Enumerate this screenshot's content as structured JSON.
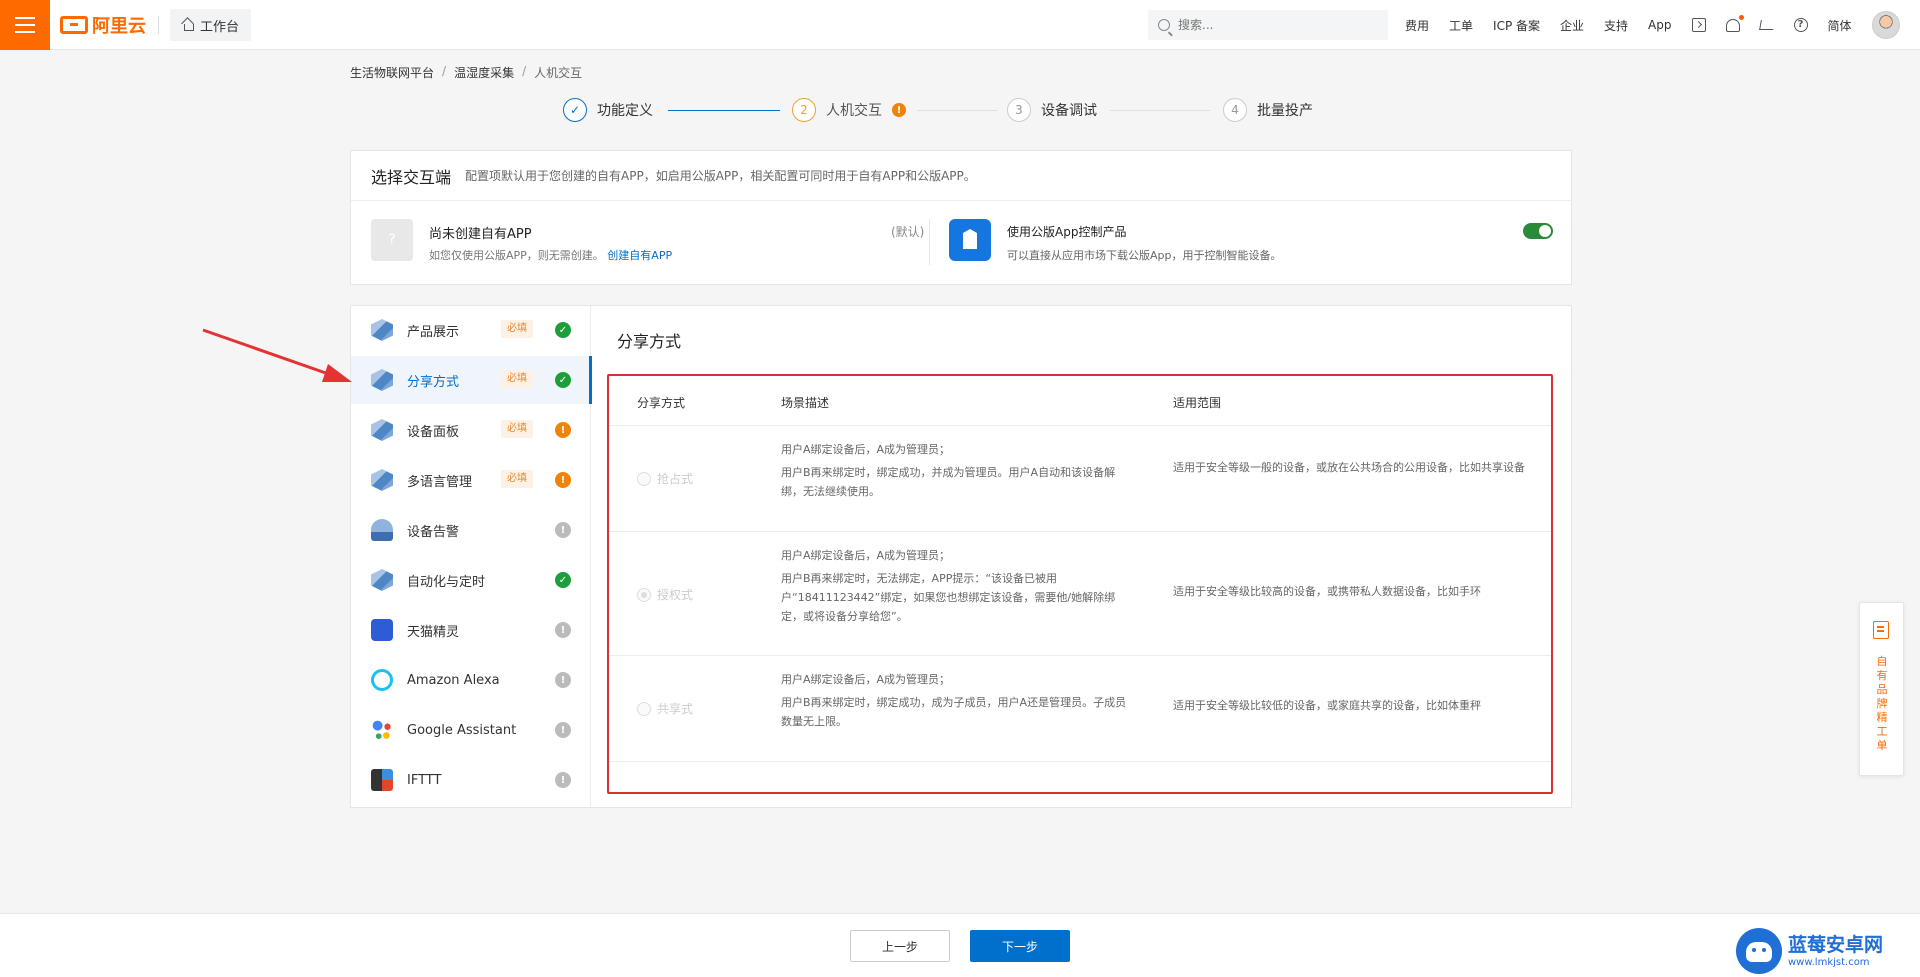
{
  "header": {
    "logo_text": "阿里云",
    "workbench_label": "工作台",
    "search_placeholder": "搜索...",
    "nav": [
      "费用",
      "工单",
      "ICP 备案",
      "企业",
      "支持",
      "App"
    ],
    "lang": "简体",
    "brand_color": "#ff6a00"
  },
  "breadcrumb": [
    "生活物联网平台",
    "温湿度采集",
    "人机交互"
  ],
  "steps": [
    {
      "num": "✓",
      "label": "功能定义",
      "state": "done"
    },
    {
      "num": "2",
      "label": "人机交互",
      "state": "active",
      "badge": "!"
    },
    {
      "num": "3",
      "label": "设备调试",
      "state": "pending"
    },
    {
      "num": "4",
      "label": "批量投产",
      "state": "pending"
    }
  ],
  "endpoint": {
    "title": "选择交互端",
    "desc": "配置项默认用于您创建的自有APP，如启用公版APP，相关配置可同时用于自有APP和公版APP。",
    "own_placeholder": "?",
    "own_title": "尚未创建自有APP",
    "own_desc": "如您仅使用公版APP，则无需创建。",
    "own_link": "创建自有APP",
    "own_default": "(默认)",
    "pub_title": "使用公版App控制产品",
    "pub_desc": "可以直接从应用市场下载公版App，用于控制智能设备。",
    "pub_enabled": true
  },
  "sidebar": {
    "required_label": "必填",
    "items": [
      {
        "label": "产品展示",
        "required": true,
        "status": "ok",
        "icon": "product-display-icon"
      },
      {
        "label": "分享方式",
        "required": true,
        "status": "ok",
        "icon": "share-icon",
        "active": true
      },
      {
        "label": "设备面板",
        "required": true,
        "status": "warn",
        "icon": "device-panel-icon"
      },
      {
        "label": "多语言管理",
        "required": true,
        "status": "warn",
        "icon": "language-icon"
      },
      {
        "label": "设备告警",
        "required": false,
        "status": "info",
        "icon": "alarm-icon"
      },
      {
        "label": "自动化与定时",
        "required": false,
        "status": "ok",
        "icon": "automation-icon"
      },
      {
        "label": "天猫精灵",
        "required": false,
        "status": "info",
        "icon": "tmall-genie-icon"
      },
      {
        "label": "Amazon Alexa",
        "required": false,
        "status": "info",
        "icon": "alexa-icon"
      },
      {
        "label": "Google Assistant",
        "required": false,
        "status": "info",
        "icon": "google-assistant-icon"
      },
      {
        "label": "IFTTT",
        "required": false,
        "status": "info",
        "icon": "ifttt-icon"
      }
    ]
  },
  "share": {
    "title": "分享方式",
    "headers": [
      "分享方式",
      "场景描述",
      "适用范围"
    ],
    "rows": [
      {
        "mode": "抢占式",
        "checked": false,
        "desc": [
          "用户A绑定设备后，A成为管理员；",
          "用户B再来绑定时，绑定成功，并成为管理员。用户A自动和该设备解绑，无法继续使用。"
        ],
        "scope": "适用于安全等级一般的设备，或放在公共场合的公用设备，比如共享设备"
      },
      {
        "mode": "授权式",
        "checked": true,
        "desc": [
          "用户A绑定设备后，A成为管理员；",
          "用户B再来绑定时，无法绑定，APP提示：“该设备已被用户“18411123442”绑定，如果您也想绑定该设备，需要他/她解除绑定，或将设备分享给您”。"
        ],
        "scope": "适用于安全等级比较高的设备，或携带私人数据设备，比如手环"
      },
      {
        "mode": "共享式",
        "checked": false,
        "desc": [
          "用户A绑定设备后，A成为管理员；",
          "用户B再来绑定时，绑定成功，成为子成员，用户A还是管理员。子成员数量无上限。"
        ],
        "scope": "适用于安全等级比较低的设备，或家庭共享的设备，比如体重秤"
      }
    ]
  },
  "float_tab": {
    "label": "自有品牌精工单"
  },
  "footer": {
    "prev": "上一步",
    "next": "下一步"
  },
  "watermark": {
    "title": "蓝莓安卓网",
    "url": "www.lmkjst.com"
  }
}
